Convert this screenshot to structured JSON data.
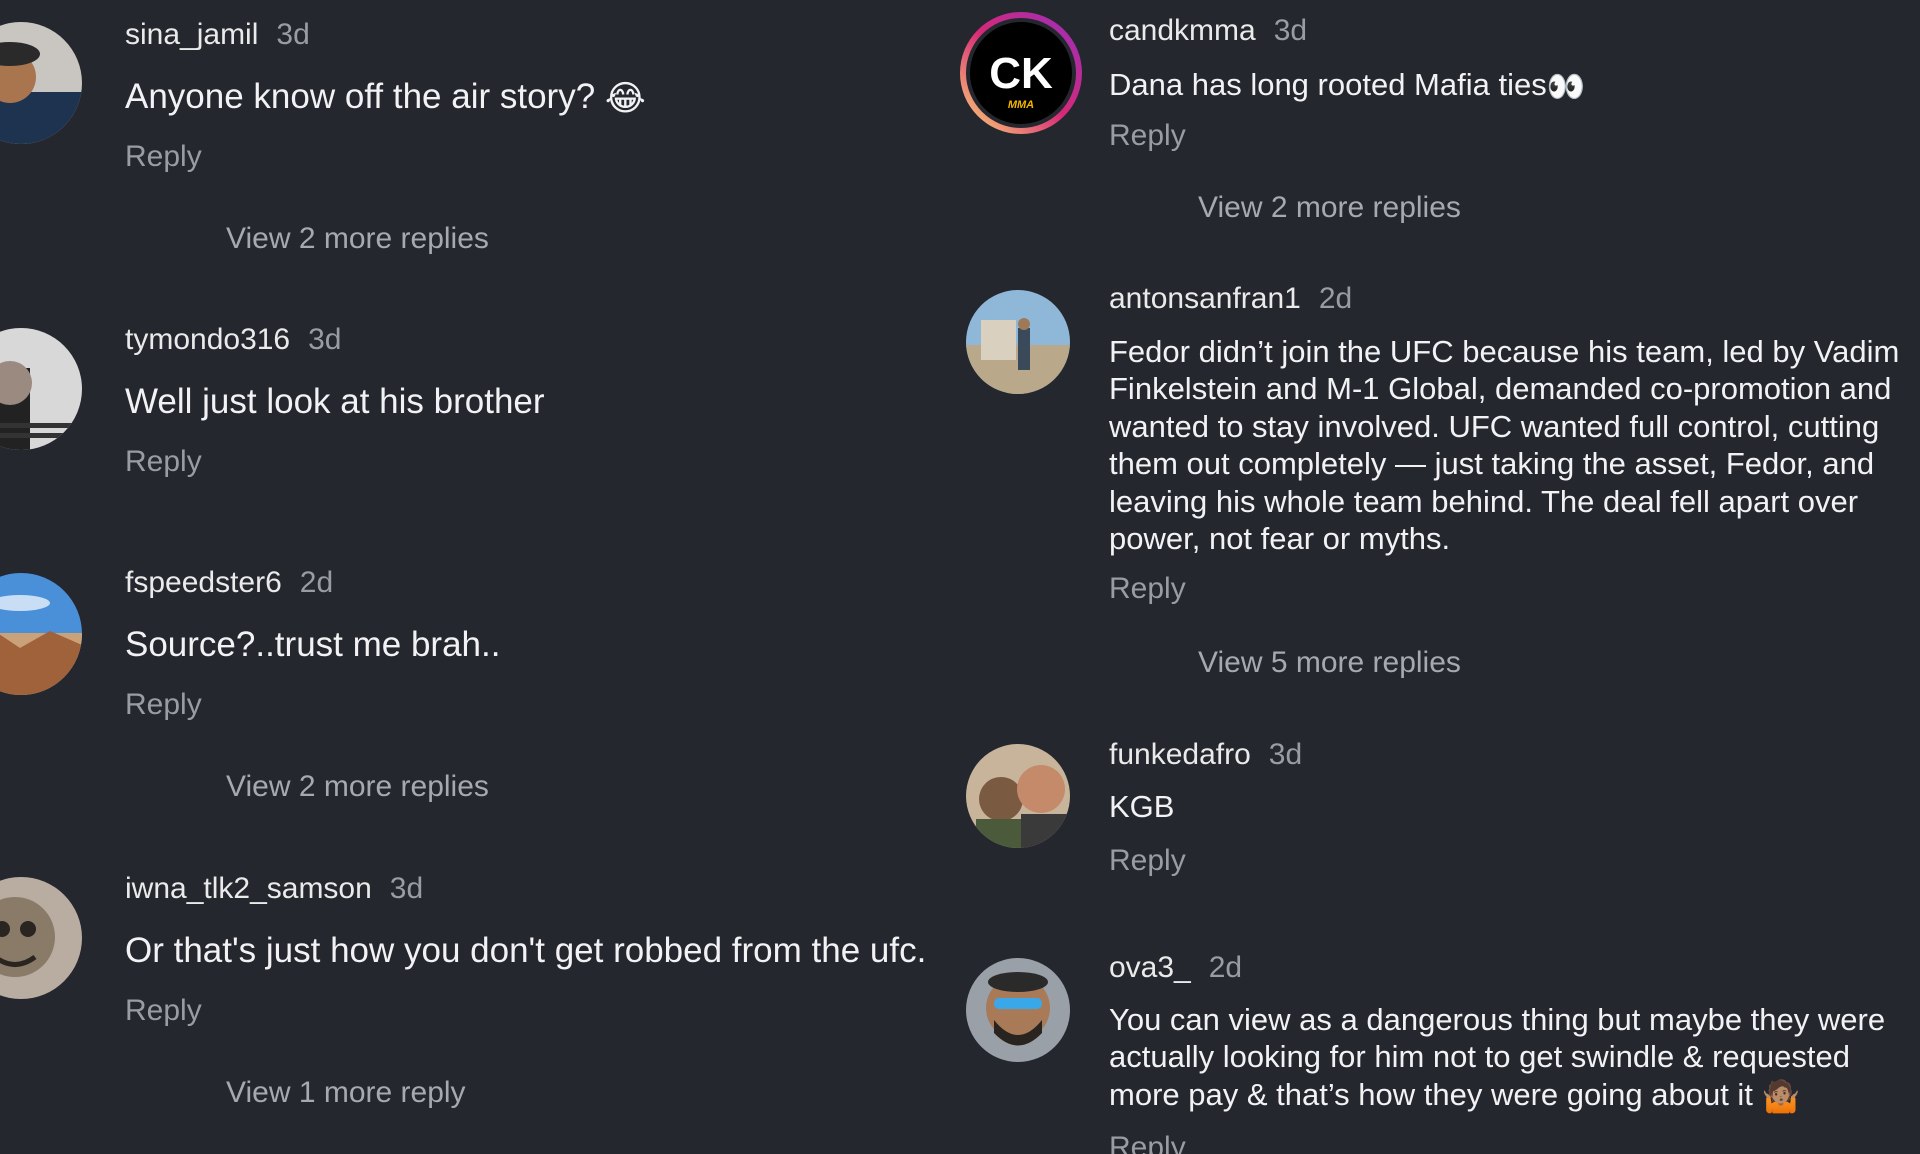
{
  "left": [
    {
      "username": "sina_jamil",
      "time": "3d",
      "text": "Anyone know off the air story?",
      "emoji": "😂",
      "reply": "Reply",
      "more": "View 2 more replies"
    },
    {
      "username": "tymondo316",
      "time": "3d",
      "text": "Well just look at his brother",
      "reply": "Reply"
    },
    {
      "username": "fspeedster6",
      "time": "2d",
      "text": "Source?..trust me brah..",
      "reply": "Reply",
      "more": "View 2 more replies"
    },
    {
      "username": "iwna_tlk2_samson",
      "time": "3d",
      "text": "Or that's just how you don't get robbed from the ufc.",
      "reply": "Reply",
      "more": "View 1 more reply"
    }
  ],
  "right": [
    {
      "username": "candkmma",
      "time": "3d",
      "text": "Dana has long rooted Mafia ties",
      "emoji": "👀",
      "reply": "Reply",
      "more": "View 2 more replies",
      "avatar_text": "CK",
      "avatar_sub": "MMA"
    },
    {
      "username": "antonsanfran1",
      "time": "2d",
      "text": "Fedor didn’t join the UFC because his team, led by Vadim Finkelstein and M-1 Global, demanded co-promotion and wanted to stay involved. UFC wanted full control, cutting them out completely — just taking the asset, Fedor, and leaving his whole team behind. The deal fell apart over power, not fear or myths.",
      "reply": "Reply",
      "more": "View 5 more replies"
    },
    {
      "username": "funkedafro",
      "time": "3d",
      "text": "KGB",
      "reply": "Reply"
    },
    {
      "username": "ova3_",
      "time": "2d",
      "text": "You can view as a dangerous thing but maybe they were actually looking for him not to get swindle & requested more pay & that’s how they were going about it",
      "emoji": "🤷🏽",
      "reply": "Reply"
    }
  ],
  "colors": {
    "background": "#25272f",
    "secondary_text": "#9a9ca3",
    "primary_text": "#f2f2f4",
    "avatar_ring": "#d62976"
  }
}
